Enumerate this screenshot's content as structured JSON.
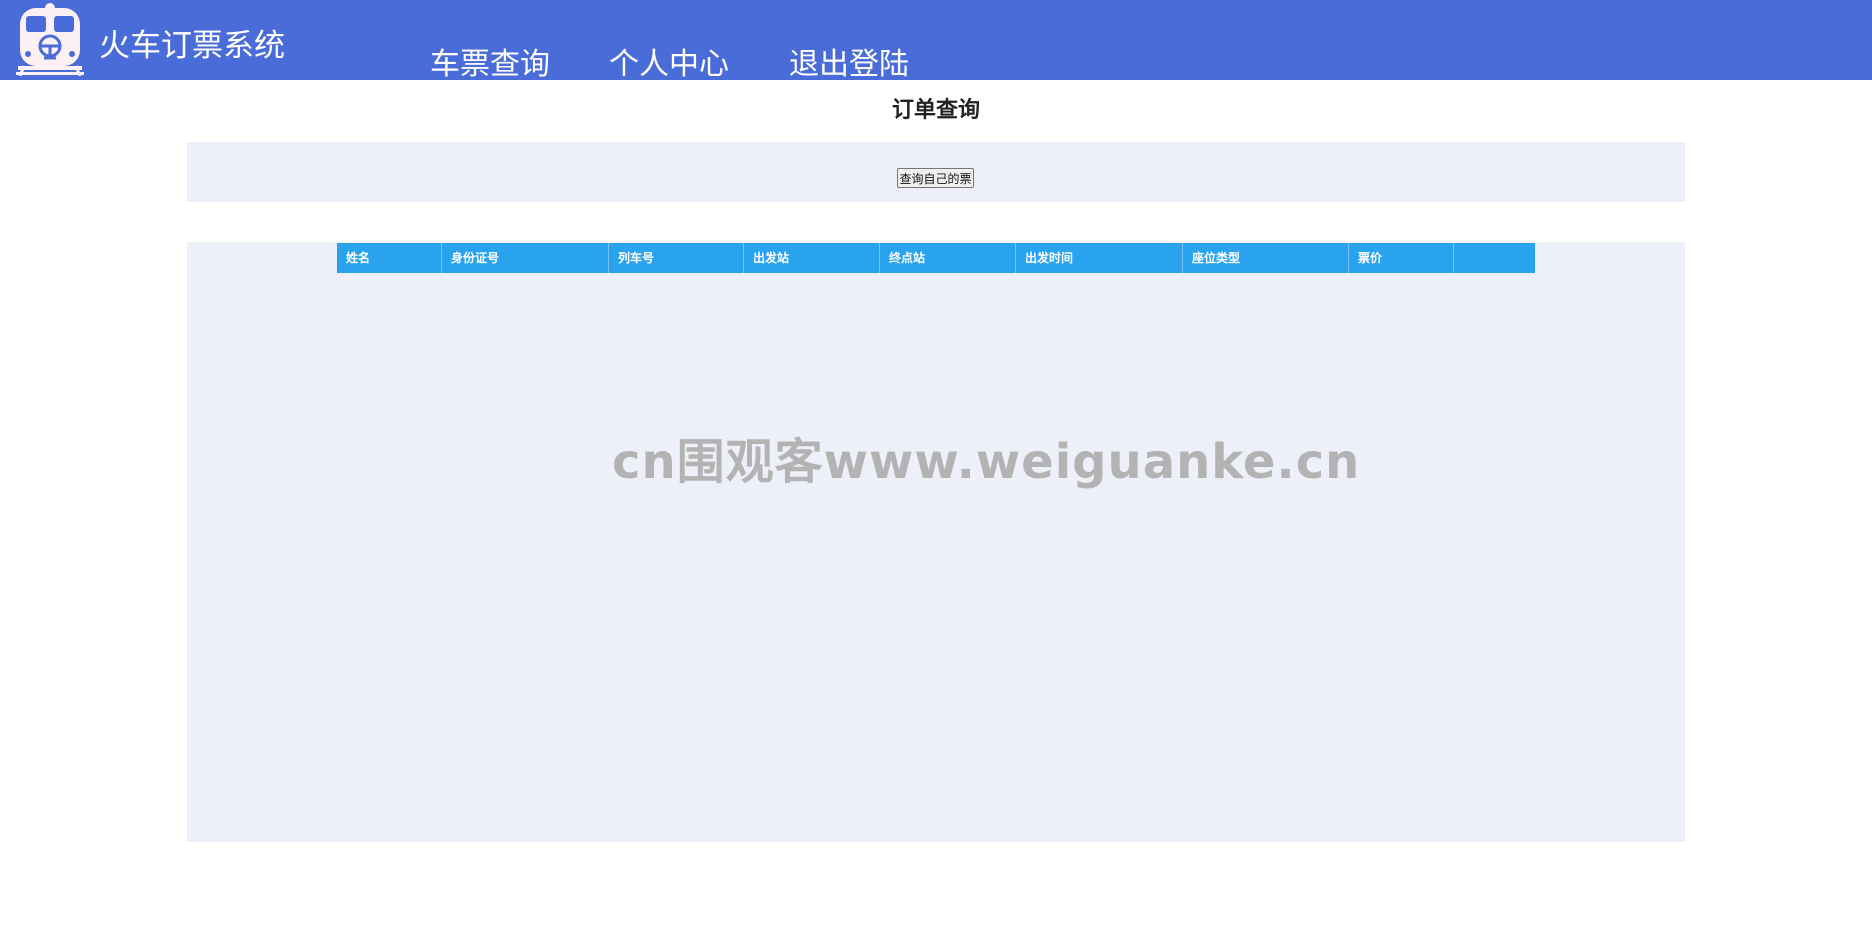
{
  "header": {
    "app_title": "火车订票系统",
    "nav": [
      {
        "label": "车票查询"
      },
      {
        "label": "个人中心"
      },
      {
        "label": "退出登陆"
      }
    ]
  },
  "main": {
    "page_title": "订单查询",
    "query_button_label": "查询自己的票",
    "table": {
      "columns": [
        "姓名",
        "身份证号",
        "列车号",
        "出发站",
        "终点站",
        "出发时间",
        "座位类型",
        "票价",
        ""
      ],
      "rows": []
    }
  },
  "watermark": "cn围观客www.weiguanke.cn",
  "colors": {
    "header_bg": "#4a6cd8",
    "table_header_bg": "#2aa3ef",
    "panel_bg": "#edf0f8"
  },
  "icons": {
    "logo": "train-logo-icon"
  }
}
